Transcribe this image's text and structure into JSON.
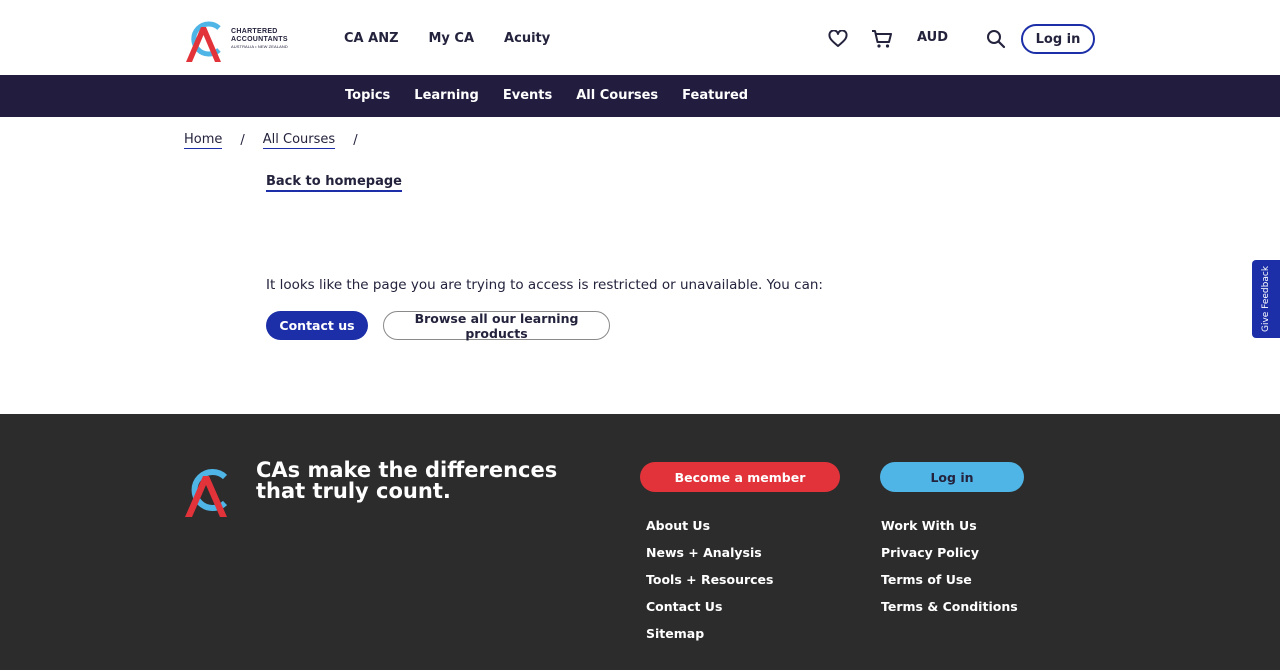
{
  "brand": {
    "logo_line1": "CHARTERED",
    "logo_line2": "ACCOUNTANTS",
    "logo_line3": "AUSTRALIA • NEW ZEALAND",
    "colors": {
      "navy": "#221d3f",
      "blue": "#1c2fa8",
      "red": "#e2333b",
      "light_blue": "#4fb4e6",
      "footer_bg": "#2d2c2c"
    }
  },
  "header": {
    "nav": [
      "CA ANZ",
      "My CA",
      "Acuity"
    ],
    "icons": [
      "heart-icon",
      "cart-icon",
      "search-icon"
    ],
    "currency": "AUD",
    "login_label": "Log in"
  },
  "subnav": {
    "items": [
      "Topics",
      "Learning",
      "Events",
      "All Courses",
      "Featured"
    ]
  },
  "breadcrumb": {
    "home": "Home",
    "all_courses": "All Courses",
    "separator": "/"
  },
  "main": {
    "back_link": "Back to homepage",
    "message": "It looks like the page you are trying to access is restricted or unavailable. You can:",
    "contact_button": "Contact us",
    "browse_button": "Browse all our learning products"
  },
  "feedback_tab": "Give Feedback",
  "footer": {
    "tagline": "CAs make the differences that truly count.",
    "member_button": "Become a member",
    "login_button": "Log in",
    "col1": [
      "About Us",
      "News + Analysis",
      "Tools + Resources",
      "Contact Us",
      "Sitemap"
    ],
    "col2": [
      "Work With Us",
      "Privacy Policy",
      "Terms of Use",
      "Terms & Conditions"
    ]
  }
}
